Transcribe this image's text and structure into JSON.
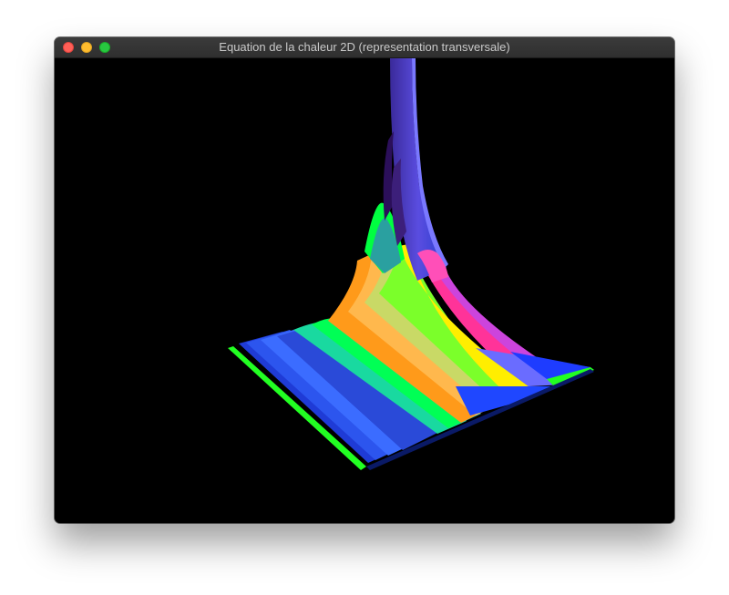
{
  "window": {
    "title": "Equation de la chaleur 2D (representation transversale)",
    "background": "#000000"
  },
  "controls": {
    "close_icon": "close-icon",
    "minimize_icon": "minimize-icon",
    "zoom_icon": "zoom-icon",
    "close_color": "#ff5f57",
    "minimize_color": "#febc2e",
    "zoom_color": "#28c840"
  },
  "scene": {
    "type": "3d-surface",
    "description_colors": [
      "#1e3cff",
      "#3aa0ff",
      "#00e5ff",
      "#00ff40",
      "#7cff00",
      "#ffee00",
      "#ff9900",
      "#ff3399",
      "#cc44ff",
      "#3a1070"
    ]
  }
}
